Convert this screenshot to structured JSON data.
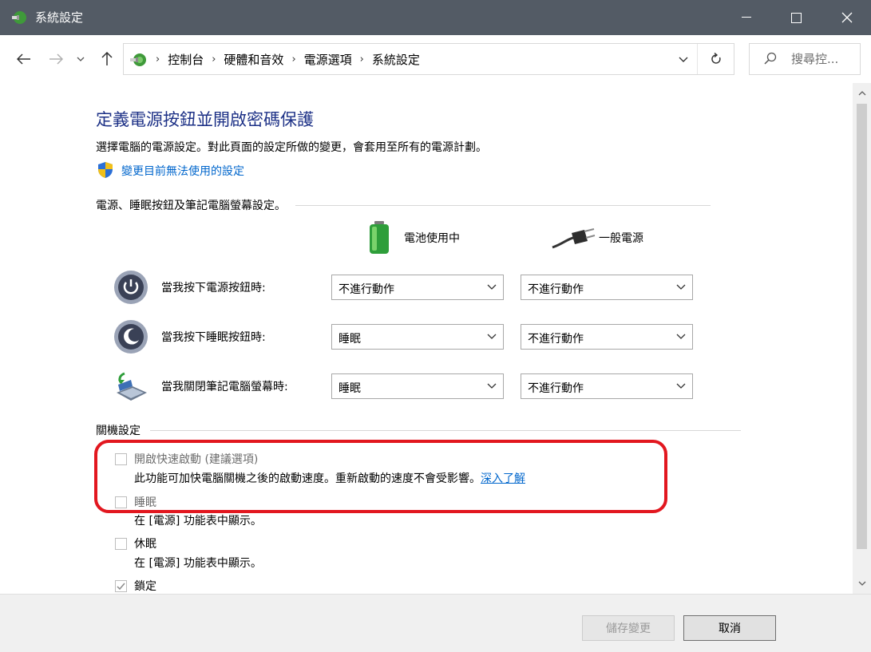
{
  "window": {
    "title": "系統設定"
  },
  "address": {
    "breadcrumbs": [
      "控制台",
      "硬體和音效",
      "電源選項",
      "系統設定"
    ],
    "search_placeholder": "搜尋控..."
  },
  "page": {
    "title": "定義電源按鈕並開啟密碼保護",
    "description": "選擇電腦的電源設定。對此頁面的設定所做的變更，會套用至所有的電源計劃。",
    "admin_link": "變更目前無法使用的設定"
  },
  "power_section": {
    "heading": "電源、睡眠按鈕及筆記電腦螢幕設定。",
    "col_battery": "電池使用中",
    "col_plugged": "一般電源",
    "rows": [
      {
        "label": "當我按下電源按鈕時:",
        "battery": "不進行動作",
        "plugged": "不進行動作"
      },
      {
        "label": "當我按下睡眠按鈕時:",
        "battery": "睡眠",
        "plugged": "不進行動作"
      },
      {
        "label": "當我關閉筆記電腦螢幕時:",
        "battery": "睡眠",
        "plugged": "不進行動作"
      }
    ]
  },
  "shutdown_section": {
    "heading": "關機設定",
    "options": [
      {
        "label": "開啟快速啟動 (建議選項)",
        "checked": false,
        "desc": "此功能可加快電腦關機之後的啟動速度。重新啟動的速度不會受影響。",
        "link": "深入了解"
      },
      {
        "label": "睡眠",
        "checked": false,
        "desc": "在 [電源] 功能表中顯示。"
      },
      {
        "label": "休眠",
        "checked": false,
        "desc": "在 [電源] 功能表中顯示。"
      },
      {
        "label": "鎖定",
        "checked": true
      }
    ]
  },
  "footer": {
    "save": "儲存變更",
    "cancel": "取消"
  },
  "colors": {
    "titlebar": "#535b65",
    "title_text": "#1e3287",
    "link": "#0066cc",
    "highlight": "#e2171f"
  }
}
